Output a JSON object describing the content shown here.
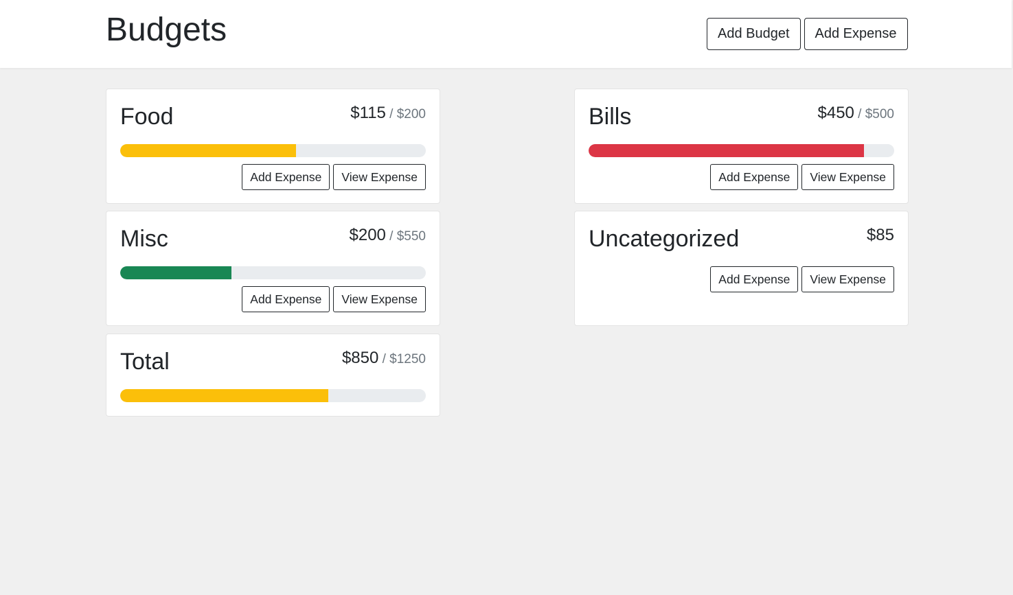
{
  "header": {
    "title": "Budgets",
    "add_budget_label": "Add Budget",
    "add_expense_label": "Add Expense"
  },
  "colors": {
    "warning": "#fbbf0a",
    "danger": "#dc3545",
    "success": "#198754",
    "track": "#e9ecef"
  },
  "cards": [
    {
      "name": "Food",
      "amount": "$115",
      "max": " / $200",
      "progress": 0.575,
      "bar_color": "#fbbf0a",
      "add_label": "Add Expense",
      "view_label": "View Expense"
    },
    {
      "name": "Bills",
      "amount": "$450",
      "max": " / $500",
      "progress": 0.9,
      "bar_color": "#dc3545",
      "add_label": "Add Expense",
      "view_label": "View Expense"
    },
    {
      "name": "Misc",
      "amount": "$200",
      "max": " / $550",
      "progress": 0.364,
      "bar_color": "#198754",
      "add_label": "Add Expense",
      "view_label": "View Expense"
    },
    {
      "name": "Uncategorized",
      "amount": "$85",
      "add_label": "Add Expense",
      "view_label": "View Expense"
    },
    {
      "name": "Total",
      "amount": "$850",
      "max": " / $1250",
      "progress": 0.68,
      "bar_color": "#fbbf0a"
    }
  ]
}
